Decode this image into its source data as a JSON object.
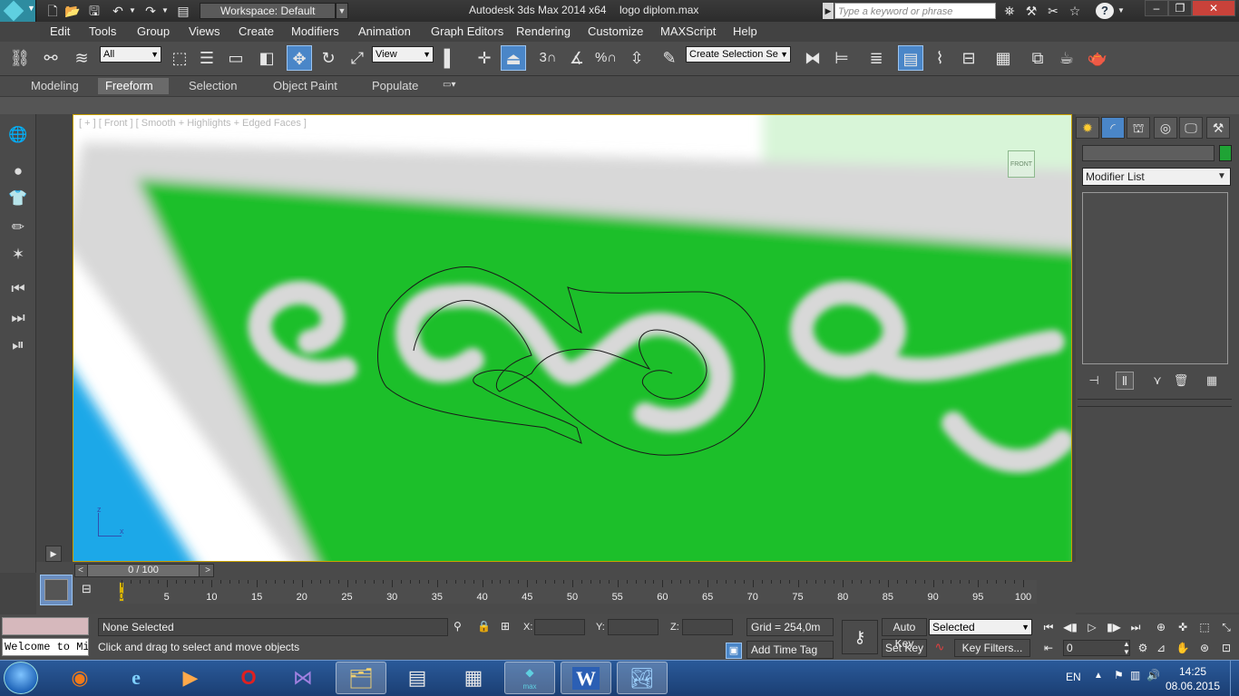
{
  "window": {
    "app_title": "Autodesk 3ds Max  2014 x64",
    "file_title": "logo diplom.max",
    "workspace": "Workspace: Default",
    "search_placeholder": "Type a keyword or phrase",
    "logo_text": "MAX"
  },
  "menu": [
    "Edit",
    "Tools",
    "Group",
    "Views",
    "Create",
    "Modifiers",
    "Animation",
    "Graph Editors",
    "Rendering",
    "Customize",
    "MAXScript",
    "Help"
  ],
  "toolbar": {
    "filter_value": "All",
    "ref_coord_value": "View",
    "selection_set_value": "Create Selection Se",
    "snap_3_label": "3",
    "percent_label": "%"
  },
  "ribbon": {
    "tabs": [
      "Modeling",
      "Freeform",
      "Selection",
      "Object Paint",
      "Populate"
    ],
    "active_tab": "Freeform"
  },
  "viewport": {
    "label": "[ + ] [ Front ] [ Smooth + Highlights + Edged Faces ]",
    "viewcube_label": "FRONT",
    "axis_z": "z",
    "axis_x": "x",
    "colors": {
      "green_fill": "#1fbf2a",
      "pale_green": "#d8f5d8",
      "blue_corner": "#1aa8e8",
      "border_gray": "#d8d8d8",
      "selected_border": "#c8a000"
    }
  },
  "command_panel": {
    "modifier_list": "Modifier List",
    "object_color": "#1fa335"
  },
  "timeline": {
    "slider_text": "0 / 100",
    "ticks": [
      5,
      10,
      15,
      20,
      25,
      30,
      35,
      40,
      45,
      50,
      55,
      60,
      65,
      70,
      75,
      80,
      85,
      90,
      95,
      100
    ],
    "marker": "0"
  },
  "status": {
    "welcome": "Welcome to Mi",
    "selection": "None Selected",
    "prompt": "Click and drag to select and move objects",
    "x_label": "X:",
    "y_label": "Y:",
    "z_label": "Z:",
    "grid": "Grid = 254,0m",
    "add_time_tag": "Add Time Tag",
    "auto_key": "Auto Key",
    "set_key": "Set Key",
    "selected_dropdown": "Selected",
    "key_filters": "Key Filters...",
    "frame_value": "0"
  },
  "taskbar": {
    "lang": "EN",
    "time": "14:25",
    "date": "08.06.2015",
    "word_label": "W",
    "max_label": "max"
  }
}
